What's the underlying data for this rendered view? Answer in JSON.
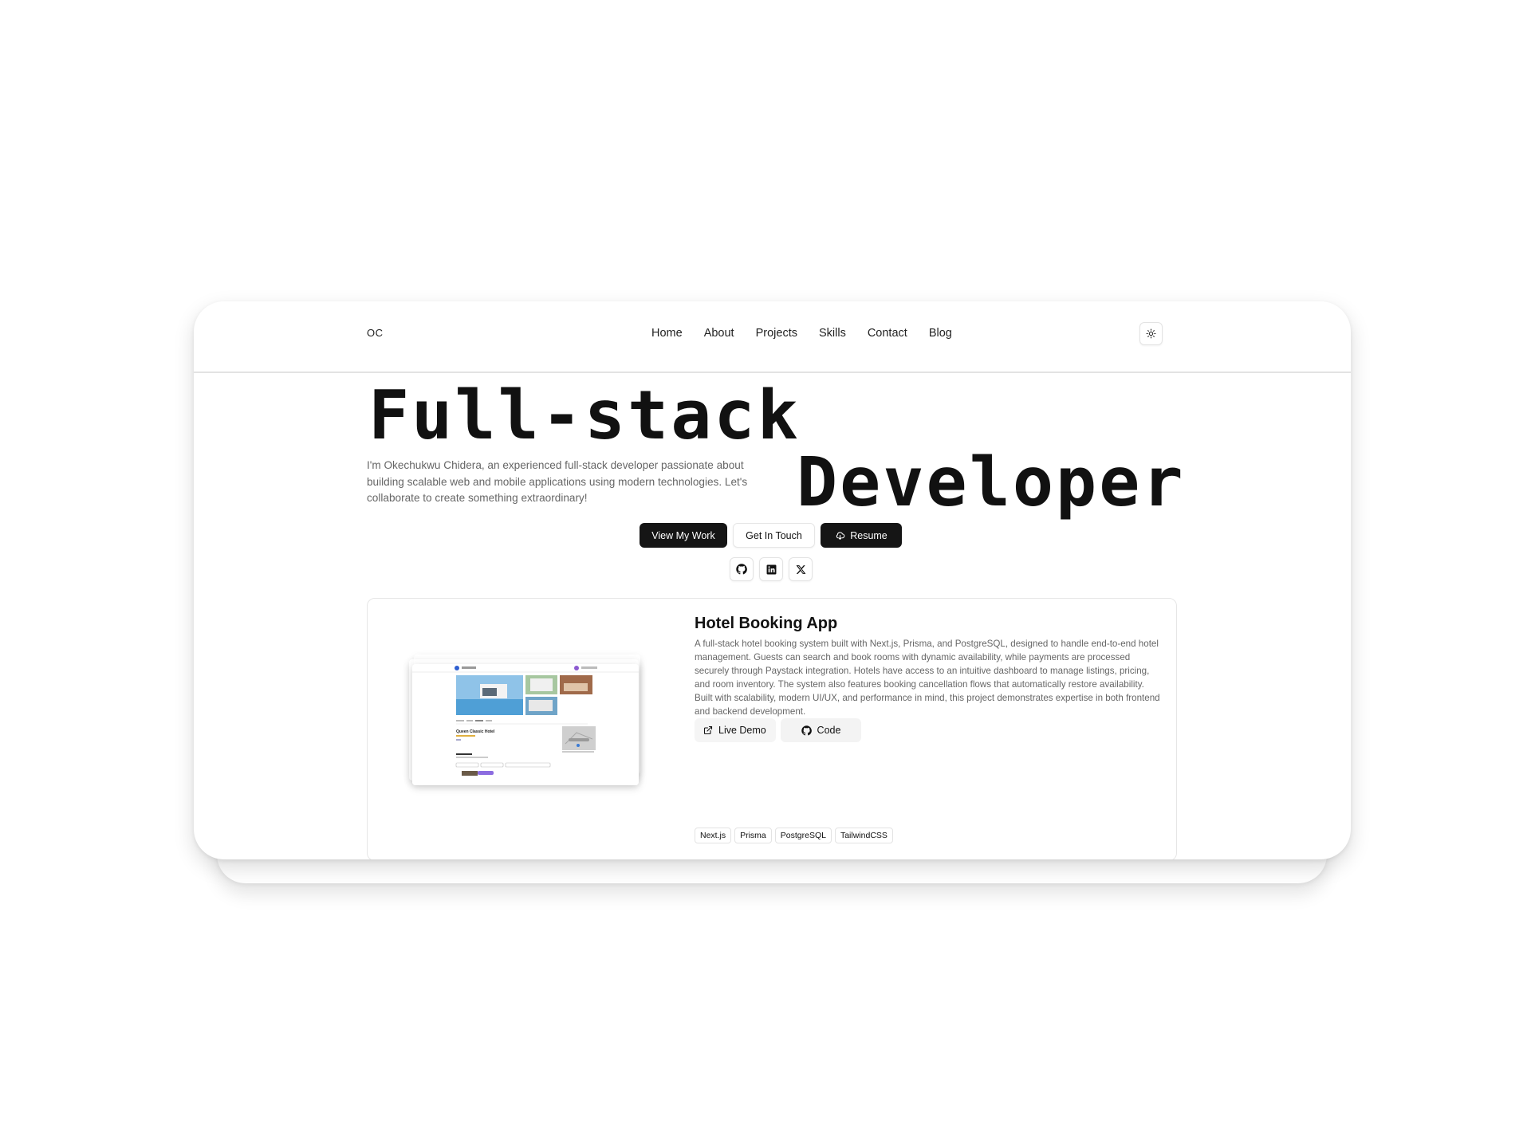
{
  "nav": {
    "logo": "OC",
    "links": [
      "Home",
      "About",
      "Projects",
      "Skills",
      "Contact",
      "Blog"
    ],
    "theme_icon": "sun-icon"
  },
  "hero": {
    "title_line1": "Full-stack",
    "title_line2": "Developer",
    "description": "I'm Okechukwu Chidera, an experienced full-stack developer passionate about building scalable web and mobile applications using modern technologies. Let's collaborate to create something extraordinary!",
    "buttons": {
      "view_work": "View My Work",
      "get_in_touch": "Get In Touch",
      "resume": "Resume"
    },
    "social_icons": [
      "github-icon",
      "linkedin-icon",
      "x-icon"
    ]
  },
  "project": {
    "title": "Hotel Booking App",
    "description": "A full-stack hotel booking system built with Next.js, Prisma, and PostgreSQL, designed to handle end-to-end hotel management. Guests can search and book rooms with dynamic availability, while payments are processed securely through Paystack integration. Hotels have access to an intuitive dashboard to manage listings, pricing, and room inventory. The system also features booking cancellation flows that automatically restore availability. Built with scalability, modern UI/UX, and performance in mind, this project demonstrates expertise in both frontend and backend development.",
    "live_demo": "Live Demo",
    "code": "Code",
    "tags": [
      "Next.js",
      "Prisma",
      "PostgreSQL",
      "TailwindCSS"
    ],
    "thumbnail_hotel_name": "Queen Classic Hotel"
  },
  "colors": {
    "dark_button": "#151515",
    "muted_text": "#666666",
    "border": "#e3e3e3"
  }
}
